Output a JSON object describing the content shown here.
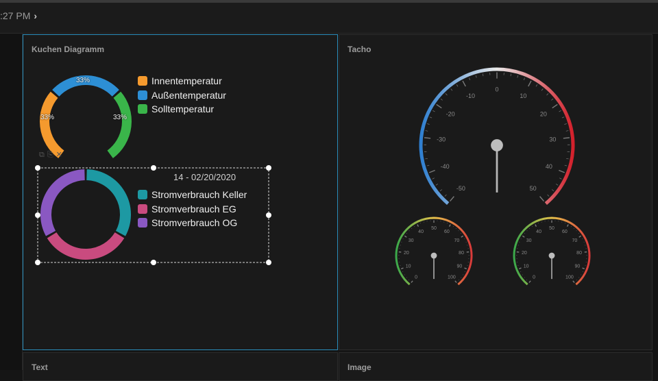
{
  "header": {
    "time": ":27 PM"
  },
  "panels": {
    "pie": {
      "title": "Kuchen Diagramm",
      "chart1": {
        "labels": [
          "33%",
          "33%",
          "33%"
        ],
        "legend": [
          "Innentemperatur",
          "Außentemperatur",
          "Solltemperatur"
        ],
        "colors": [
          "#f59a2e",
          "#2d8fd5",
          "#3ab54a"
        ]
      },
      "chart2": {
        "date": "14 - 02/20/2020",
        "legend": [
          "Stromverbrauch Keller",
          "Stromverbrauch EG",
          "Stromverbrauch OG"
        ],
        "colors": [
          "#1d99a3",
          "#c94b7f",
          "#8a58c2"
        ]
      }
    },
    "tacho": {
      "title": "Tacho",
      "main_ticks": [
        "-50",
        "-40",
        "-30",
        "-20",
        "-10",
        "0",
        "10",
        "20",
        "30",
        "40",
        "50"
      ],
      "small_ticks": [
        "0",
        "10",
        "20",
        "30",
        "40",
        "50",
        "60",
        "70",
        "80",
        "90",
        "100"
      ]
    },
    "text": {
      "title": "Text"
    },
    "image": {
      "title": "Image"
    }
  },
  "chart_data": [
    {
      "type": "pie",
      "categories": [
        "Innentemperatur",
        "Außentemperatur",
        "Solltemperatur"
      ],
      "values": [
        33,
        33,
        33
      ],
      "colors": [
        "#f59a2e",
        "#2d8fd5",
        "#3ab54a"
      ]
    },
    {
      "type": "pie",
      "categories": [
        "Stromverbrauch Keller",
        "Stromverbrauch EG",
        "Stromverbrauch OG"
      ],
      "values": [
        1,
        1,
        1
      ],
      "colors": [
        "#1d99a3",
        "#c94b7f",
        "#8a58c2"
      ]
    }
  ]
}
